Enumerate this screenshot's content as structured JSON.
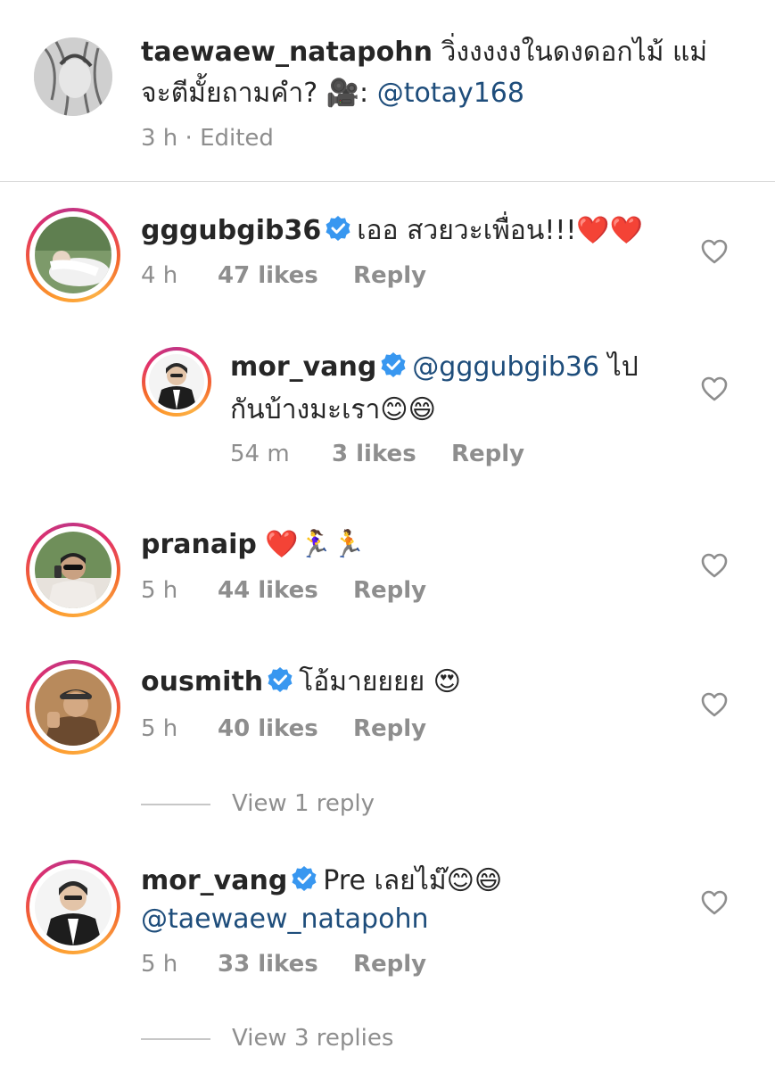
{
  "caption": {
    "username": "taewaew_natapohn",
    "text_line1": "วิ่งงงงงในดงดอกไม้ แม่",
    "text_line2": "จะตีมั้ยถามคำ? 🎥: ",
    "mention": "@totay168",
    "meta": "3 h · Edited"
  },
  "comments": [
    {
      "username": "gggubgib36",
      "verified": true,
      "text": "เออ สวยวะเพื่อน!!!❤️❤️",
      "time": "4 h",
      "likes": "47 likes",
      "reply": "Reply"
    },
    {
      "username": "mor_vang",
      "verified": true,
      "mention": "@gggubgib36",
      "text_after": " ไป",
      "text_line2": "กันบ้างมะเรา😊😄",
      "time": "54 m",
      "likes": "3 likes",
      "reply": "Reply"
    },
    {
      "username": "pranaip",
      "verified": false,
      "text": "❤️🏃‍♀️🏃",
      "time": "5 h",
      "likes": "44 likes",
      "reply": "Reply"
    },
    {
      "username": "ousmith",
      "verified": true,
      "text": "โอ้มายยยย 😍",
      "time": "5 h",
      "likes": "40 likes",
      "reply": "Reply",
      "view_replies": "View 1 reply"
    },
    {
      "username": "mor_vang",
      "verified": true,
      "text": "Pre เลยไม๊😊😄",
      "mention_line2": "@taewaew_natapohn",
      "time": "5 h",
      "likes": "33 likes",
      "reply": "Reply",
      "view_replies": "View 3 replies"
    }
  ],
  "icons": {
    "heart": "heart-outline-icon",
    "verified": "verified-badge-icon"
  },
  "colors": {
    "mention": "#1e4d7b",
    "verified": "#3897f0",
    "meta": "#8e8e8e"
  }
}
